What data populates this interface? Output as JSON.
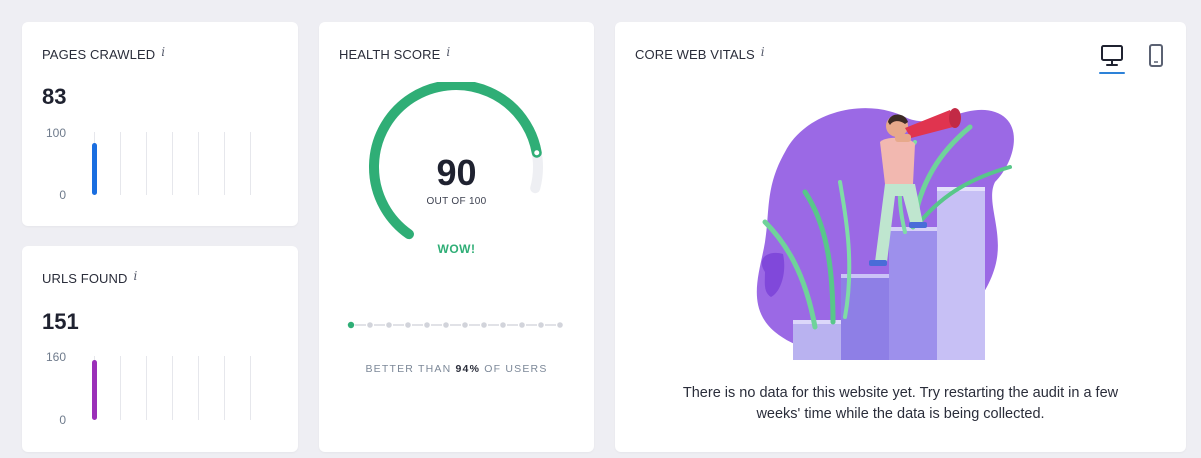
{
  "pages_crawled": {
    "title": "PAGES CRAWLED",
    "value": "83",
    "axis_max": "100",
    "axis_min": "0",
    "bar_fraction": 0.83,
    "bar_color": "#1a6ee0"
  },
  "urls_found": {
    "title": "URLS FOUND",
    "value": "151",
    "axis_max": "160",
    "axis_min": "0",
    "bar_fraction": 0.94,
    "bar_color": "#9b2fb8"
  },
  "health_score": {
    "title": "HEALTH SCORE",
    "score": "90",
    "score_fraction": 0.9,
    "out_of": "OUT OF 100",
    "badge": "WOW!",
    "accent": "#2fae76",
    "track_color": "#eeeff3",
    "better_prefix": "BETTER THAN ",
    "better_percent": "94%",
    "better_suffix": " OF USERS",
    "dot_count": 12,
    "active_dot": 0
  },
  "core_web_vitals": {
    "title": "CORE WEB VITALS",
    "devices": [
      {
        "name": "desktop",
        "icon": "desktop-icon",
        "active": true
      },
      {
        "name": "mobile",
        "icon": "mobile-icon",
        "active": false
      }
    ],
    "empty_message": "There is no data for this website yet. Try restarting the audit in a few weeks' time while the data is being collected.",
    "illustration": "person-with-telescope-on-bar-steps"
  },
  "info_icon": "i",
  "colors": {
    "background": "#eeeef3",
    "card": "#ffffff",
    "active_tab": "#2d82d8",
    "purple": "#8a4fe0"
  }
}
